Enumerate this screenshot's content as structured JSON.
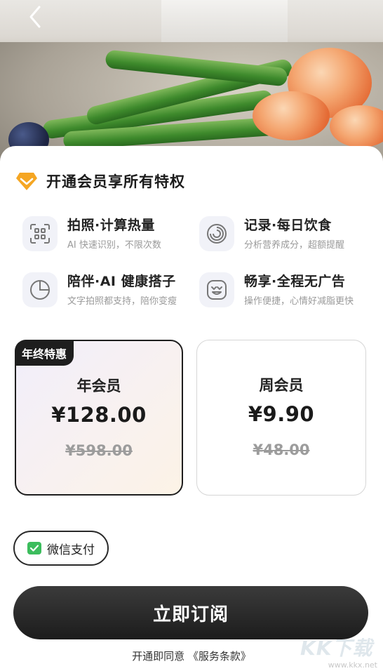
{
  "header": {
    "back_icon": "chevron-left-icon"
  },
  "membership": {
    "title": "开通会员享所有特权",
    "title_icon": "diamond-icon",
    "accent": "#f5a623"
  },
  "features": [
    {
      "icon": "scan-icon",
      "title": "拍照·计算热量",
      "subtitle": "AI 快速识别，不限次数"
    },
    {
      "icon": "spiral-icon",
      "title": "记录·每日饮食",
      "subtitle": "分析营养成分，超额提醒"
    },
    {
      "icon": "pie-chart-icon",
      "title": "陪伴·AI 健康搭子",
      "subtitle": "文字拍照都支持，陪你变瘦"
    },
    {
      "icon": "smile-icon",
      "title": "畅享·全程无广告",
      "subtitle": "操作便捷，心情好减脂更快"
    }
  ],
  "plans": [
    {
      "badge": "年终特惠",
      "name": "年会员",
      "price": "¥128.00",
      "original_price": "¥598.00",
      "selected": true
    },
    {
      "badge": "",
      "name": "周会员",
      "price": "¥9.90",
      "original_price": "¥48.00",
      "selected": false
    }
  ],
  "payment": {
    "label": "微信支付",
    "icon": "wechat-pay-icon",
    "color": "#3cbd5d"
  },
  "subscribe_button": "立即订阅",
  "terms": {
    "prefix": "开通即同意",
    "link": "《服务条款》"
  },
  "watermark": {
    "text": "KK下载",
    "url": "www.kkx.net"
  }
}
